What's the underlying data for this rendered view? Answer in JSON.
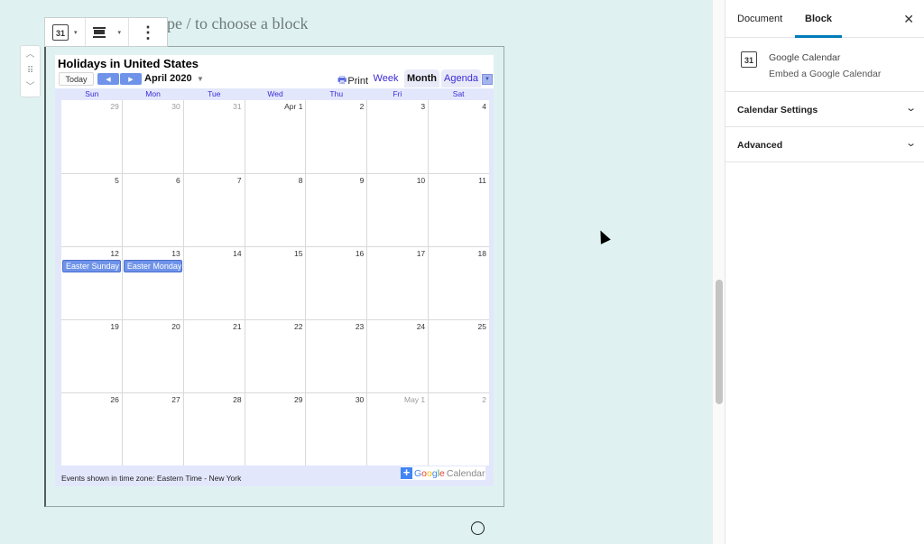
{
  "editor": {
    "placeholder": "Start writing or type / to choose a block",
    "visible_placeholder": "type / to choose a block",
    "mover": {
      "up_icon": "chevron-up",
      "drag_icon": "drag-handle",
      "down_icon": "chevron-down"
    },
    "toolbar": {
      "block_type_icon_text": "31",
      "block_type_caret": "▾",
      "align_caret": "▾",
      "more_icon": "⋮"
    },
    "inserter_icon": "⊕"
  },
  "calendar": {
    "title": "Holidays in United States",
    "today_label": "Today",
    "prev_icon": "◀",
    "next_icon": "▶",
    "month_label": "April 2020",
    "month_caret": "▼",
    "print_label": "Print",
    "print_icon": "🖶",
    "views": [
      "Week",
      "Month",
      "Agenda"
    ],
    "active_view": "Month",
    "view_dropdown_icon": "▼",
    "days_of_week": [
      "Sun",
      "Mon",
      "Tue",
      "Wed",
      "Thu",
      "Fri",
      "Sat"
    ],
    "weeks": [
      [
        {
          "label": "29",
          "other": true
        },
        {
          "label": "30",
          "other": true
        },
        {
          "label": "31",
          "other": true
        },
        {
          "label": "Apr 1"
        },
        {
          "label": "2"
        },
        {
          "label": "3"
        },
        {
          "label": "4"
        }
      ],
      [
        {
          "label": "5"
        },
        {
          "label": "6"
        },
        {
          "label": "7"
        },
        {
          "label": "8"
        },
        {
          "label": "9"
        },
        {
          "label": "10"
        },
        {
          "label": "11"
        }
      ],
      [
        {
          "label": "12",
          "event": "Easter Sunday"
        },
        {
          "label": "13",
          "event": "Easter Monday"
        },
        {
          "label": "14"
        },
        {
          "label": "15"
        },
        {
          "label": "16"
        },
        {
          "label": "17"
        },
        {
          "label": "18"
        }
      ],
      [
        {
          "label": "19"
        },
        {
          "label": "20"
        },
        {
          "label": "21"
        },
        {
          "label": "22"
        },
        {
          "label": "23"
        },
        {
          "label": "24"
        },
        {
          "label": "25"
        }
      ],
      [
        {
          "label": "26"
        },
        {
          "label": "27"
        },
        {
          "label": "28"
        },
        {
          "label": "29"
        },
        {
          "label": "30"
        },
        {
          "label": "May 1",
          "other": true
        },
        {
          "label": "2",
          "other": true
        }
      ]
    ],
    "timezone_note": "Events shown in time zone: Eastern Time - New York",
    "badge": {
      "plus": "+",
      "google": "Google",
      "calendar": "Calendar"
    },
    "colors": {
      "event": "#6f93e9",
      "header_text": "#3b2ad6",
      "frame": "#e3e7fc"
    }
  },
  "sidebar": {
    "tabs": [
      "Document",
      "Block"
    ],
    "active_tab": "Block",
    "close_icon": "✕",
    "block_card": {
      "icon_text": "31",
      "title": "Google Calendar",
      "description": "Embed a Google Calendar"
    },
    "panels": [
      {
        "title": "Calendar Settings",
        "expanded": false
      },
      {
        "title": "Advanced",
        "expanded": false
      }
    ],
    "chevron": "⌄",
    "accent": "#007cba"
  }
}
